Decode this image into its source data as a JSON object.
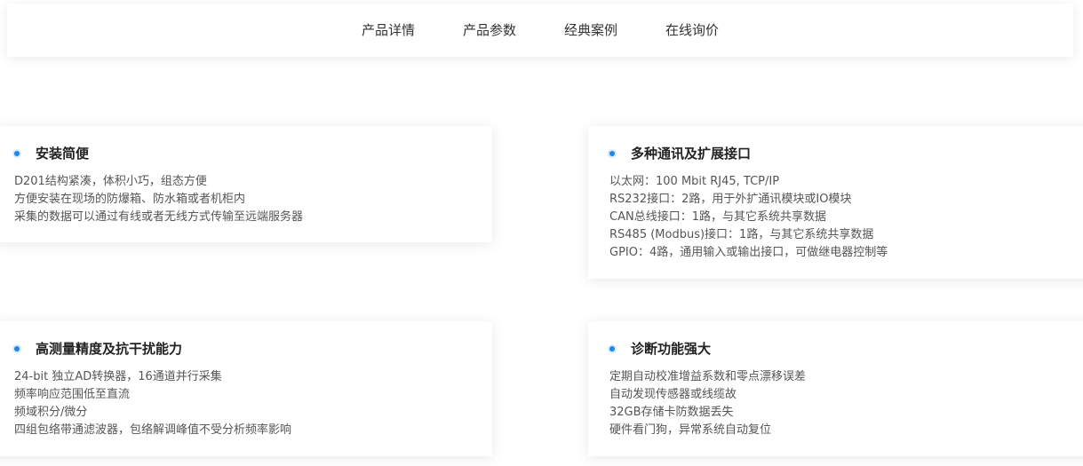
{
  "tabs": [
    "产品详情",
    "产品参数",
    "经典案例",
    "在线询价"
  ],
  "features": [
    {
      "title": "安装简便",
      "lines": [
        "D201结构紧凑，体积小巧，组态方便",
        "方便安装在现场的防爆箱、防水箱或者机柜内",
        "采集的数据可以通过有线或者无线方式传输至远端服务器"
      ]
    },
    {
      "title": "多种通讯及扩展接口",
      "lines": [
        "以太网：100 Mbit RJ45, TCP/IP",
        "RS232接口：2路，用于外扩通讯模块或IO模块",
        "CAN总线接口：1路，与其它系统共享数据",
        "RS485 (Modbus)接口：1路，与其它系统共享数据",
        "GPIO：4路，通用输入或输出接口，可做继电器控制等"
      ]
    },
    {
      "title": "高测量精度及抗干扰能力",
      "lines": [
        "24-bit 独立AD转换器，16通道并行采集",
        "频率响应范围低至直流",
        "频域积分/微分",
        "四组包络带通滤波器，包络解调峰值不受分析频率影响"
      ]
    },
    {
      "title": "诊断功能强大",
      "lines": [
        "定期自动校准增益系数和零点漂移误差",
        "自动发现传感器或线缆故",
        "32GB存储卡防数据丢失",
        "硬件看门狗，异常系统自动复位"
      ]
    }
  ],
  "colors": {
    "accent": "#1e88e5",
    "text": "#333333",
    "body_text": "#555555"
  },
  "icons": {
    "bullet": "bullet-dot-icon"
  }
}
